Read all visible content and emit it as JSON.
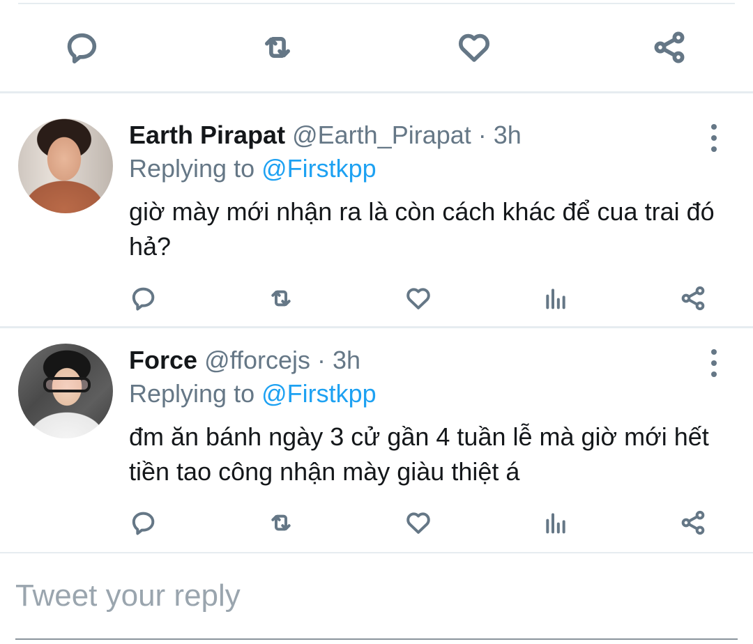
{
  "main_actions": {
    "reply_icon": "reply-icon",
    "retweet_icon": "retweet-icon",
    "like_icon": "heart-icon",
    "share_icon": "share-icon"
  },
  "tweets": [
    {
      "display_name": "Earth Pirapat",
      "handle": "@Earth_Pirapat",
      "time": " · 3h",
      "replying_prefix": "Replying to ",
      "replying_to": "@Firstkpp",
      "text": "giờ mày mới nhận ra là còn cách khác để cua trai đó hả?"
    },
    {
      "display_name": "Force",
      "handle": "@fforcejs",
      "time": " · 3h",
      "replying_prefix": "Replying to ",
      "replying_to": "@Firstkpp",
      "text": "đm ăn bánh ngày 3 cử gần 4 tuần lễ mà giờ mới hết tiền tao công nhận mày giàu thiệt á"
    }
  ],
  "reply_box": {
    "placeholder": "Tweet your reply",
    "value": ""
  },
  "colors": {
    "text": "#14171a",
    "secondary": "#657786",
    "accent": "#1da1f2",
    "divider": "#e6ecf0"
  }
}
